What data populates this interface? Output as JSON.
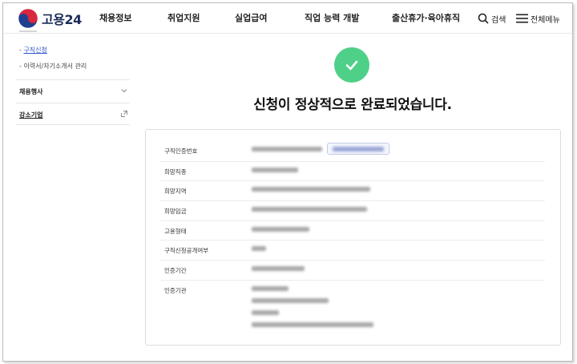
{
  "header": {
    "logo_text": "고용24",
    "nav": [
      "채용정보",
      "취업지원",
      "실업급여",
      "직업 능력 개발",
      "출산휴가·육아휴직"
    ],
    "search_label": "검색",
    "menu_label": "전체메뉴"
  },
  "sidebar": {
    "sub_items": [
      "구직신청",
      "이력서/자기소개서 관리"
    ],
    "items": [
      {
        "label": "채용행사",
        "icon": "chevron-down-icon"
      },
      {
        "label": "강소기업",
        "icon": "external-link-icon"
      }
    ]
  },
  "completion": {
    "title": "신청이 정상적으로 완료되었습니다.",
    "icon": "check-icon",
    "icon_color": "#4fd089"
  },
  "info_rows": [
    {
      "label": "구직인증번호"
    },
    {
      "label": "희망직종"
    },
    {
      "label": "희망지역"
    },
    {
      "label": "희망임금"
    },
    {
      "label": "고용형태"
    },
    {
      "label": "구직신청공개여부"
    },
    {
      "label": "인증기간"
    },
    {
      "label": "인증기관"
    }
  ]
}
